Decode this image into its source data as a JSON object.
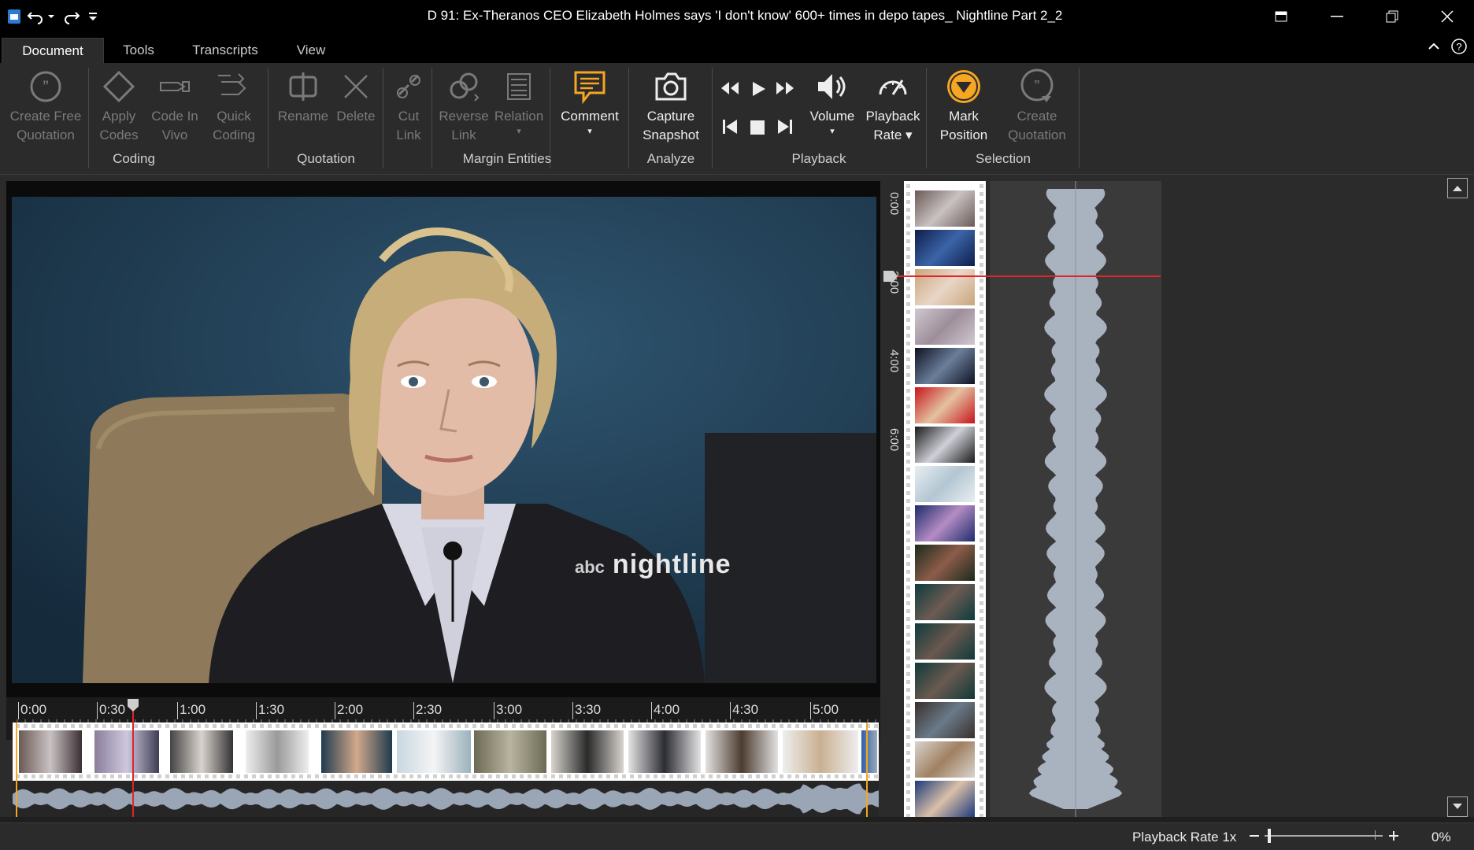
{
  "window": {
    "title": "D 91: Ex-Theranos CEO Elizabeth Holmes says 'I don't know' 600+ times in depo tapes_ Nightline Part 2_2"
  },
  "menu": {
    "tabs": [
      "Document",
      "Tools",
      "Transcripts",
      "View"
    ],
    "active": "Document"
  },
  "ribbon": {
    "groups": [
      {
        "label": "Coding"
      },
      {
        "label": "Quotation"
      },
      {
        "label": "Margin Entities"
      },
      {
        "label": "Analyze"
      },
      {
        "label": "Playback"
      },
      {
        "label": "Selection"
      }
    ],
    "buttons": [
      {
        "line1": "Create Free",
        "line2": "Quotation",
        "icon": "quote-bubble-icon",
        "enabled": false
      },
      {
        "line1": "Apply",
        "line2": "Codes",
        "icon": "diamond-icon",
        "enabled": false
      },
      {
        "line1": "Code In",
        "line2": "Vivo",
        "icon": "code-in-vivo-icon",
        "enabled": false
      },
      {
        "line1": "Quick",
        "line2": "Coding",
        "icon": "quick-coding-icon",
        "enabled": false
      },
      {
        "line1": "Rename",
        "line2": "",
        "icon": "rename-icon",
        "enabled": false
      },
      {
        "line1": "Delete",
        "line2": "",
        "icon": "delete-x-icon",
        "enabled": false
      },
      {
        "line1": "Cut",
        "line2": "Link",
        "icon": "cut-link-icon",
        "enabled": false
      },
      {
        "line1": "Reverse",
        "line2": "Link",
        "icon": "reverse-link-icon",
        "enabled": false
      },
      {
        "line1": "Relation",
        "line2": "▾",
        "icon": "relation-icon",
        "enabled": false
      },
      {
        "line1": "Comment",
        "line2": "▾",
        "icon": "comment-icon",
        "enabled": true
      },
      {
        "line1": "Capture",
        "line2": "Snapshot",
        "icon": "camera-icon",
        "enabled": true
      },
      {
        "line1": "Volume",
        "line2": "▾",
        "icon": "speaker-icon",
        "enabled": true
      },
      {
        "line1": "Playback",
        "line2": "Rate ▾",
        "icon": "gauge-icon",
        "enabled": true
      },
      {
        "line1": "Mark",
        "line2": "Position",
        "icon": "mark-position-icon",
        "enabled": true
      },
      {
        "line1": "Create",
        "line2": "Quotation",
        "icon": "create-quotation-icon",
        "enabled": false
      }
    ]
  },
  "video": {
    "watermark_prefix": "abc",
    "watermark": "nightline"
  },
  "timeline": {
    "ticks": [
      "0:00",
      "0:30",
      "1:00",
      "1:30",
      "2:00",
      "2:30",
      "3:00",
      "3:30",
      "4:00",
      "4:30",
      "5:00"
    ],
    "vertical_ticks": [
      "0:00",
      "2:00",
      "4:00",
      "6:00"
    ]
  },
  "status": {
    "playback_rate": "Playback Rate 1x",
    "zoom": "0%"
  },
  "colors": {
    "accent_orange": "#f5a623",
    "playhead_red": "#e0242a",
    "ribbon_bg": "#2b2b2b"
  }
}
